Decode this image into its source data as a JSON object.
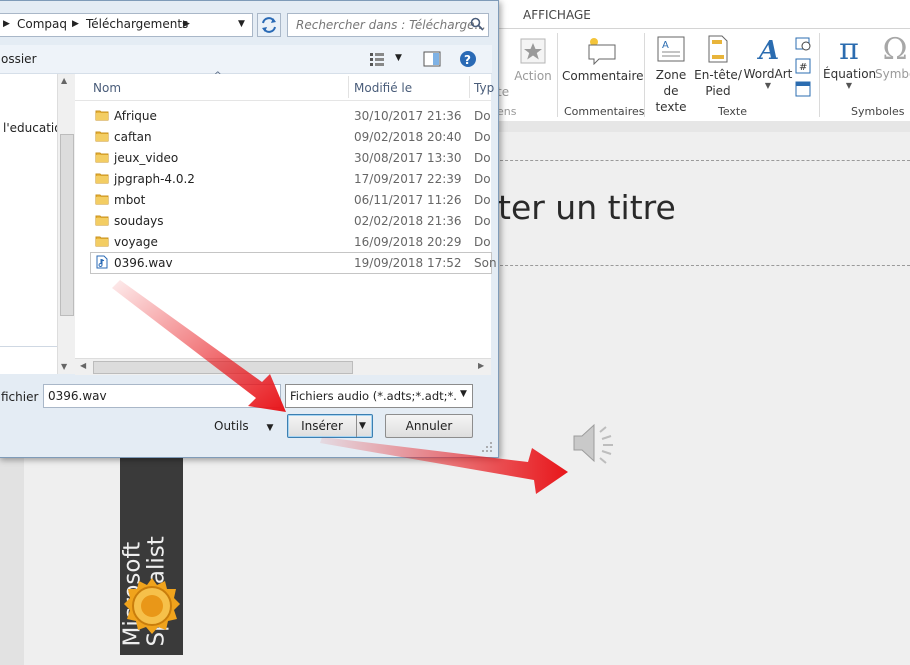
{
  "ppt": {
    "tab_label": "AFFICHAGE",
    "ribbon": {
      "action": "Action",
      "action_partial": "te",
      "links_partial": "ens",
      "comment": "Commentaire",
      "comments_group": "Commentaires",
      "zone_line1": "Zone",
      "zone_line2": "de texte",
      "header_line1": "En-tête/",
      "header_line2": "Pied",
      "wordart": "WordArt",
      "text_group": "Texte",
      "equation": "Équation",
      "symbol": "Symbo",
      "symbols_group": "Symboles"
    },
    "slide_title": "ter un titre",
    "badge_line1": "Microsoft",
    "badge_line2": "Specialist"
  },
  "dialog": {
    "breadcrumb": [
      "Compaq",
      "Téléchargements"
    ],
    "search_placeholder": "Rechercher dans : Télécharge...",
    "toolbar_label": "ossier",
    "nav_item": "l'education",
    "columns": {
      "name": "Nom",
      "modified": "Modifié le",
      "type": "Typ"
    },
    "files": [
      {
        "name": "Afrique",
        "date": "30/10/2017 21:36",
        "type": "Do",
        "kind": "folder"
      },
      {
        "name": "caftan",
        "date": "09/02/2018 20:40",
        "type": "Do",
        "kind": "folder"
      },
      {
        "name": "jeux_video",
        "date": "30/08/2017 13:30",
        "type": "Do",
        "kind": "folder"
      },
      {
        "name": "jpgraph-4.0.2",
        "date": "17/09/2017 22:39",
        "type": "Do",
        "kind": "folder"
      },
      {
        "name": "mbot",
        "date": "06/11/2017 11:26",
        "type": "Do",
        "kind": "folder"
      },
      {
        "name": "soudays",
        "date": "02/02/2018 21:36",
        "type": "Do",
        "kind": "folder"
      },
      {
        "name": "voyage",
        "date": "16/09/2018 20:29",
        "type": "Do",
        "kind": "folder"
      },
      {
        "name": "0396.wav",
        "date": "19/09/2018 17:52",
        "type": "Son",
        "kind": "audio"
      }
    ],
    "filename_label": "fichier :",
    "filename_value": "0396.wav",
    "filetype_value": "Fichiers audio (*.adts;*.adt;*.aac",
    "tools_label": "Outils",
    "insert_button": "Insérer",
    "cancel_button": "Annuler"
  },
  "colors": {
    "arrow": "#e8161b",
    "folder": "#e8b43a",
    "dialog_bg": "#e4ecf4"
  }
}
